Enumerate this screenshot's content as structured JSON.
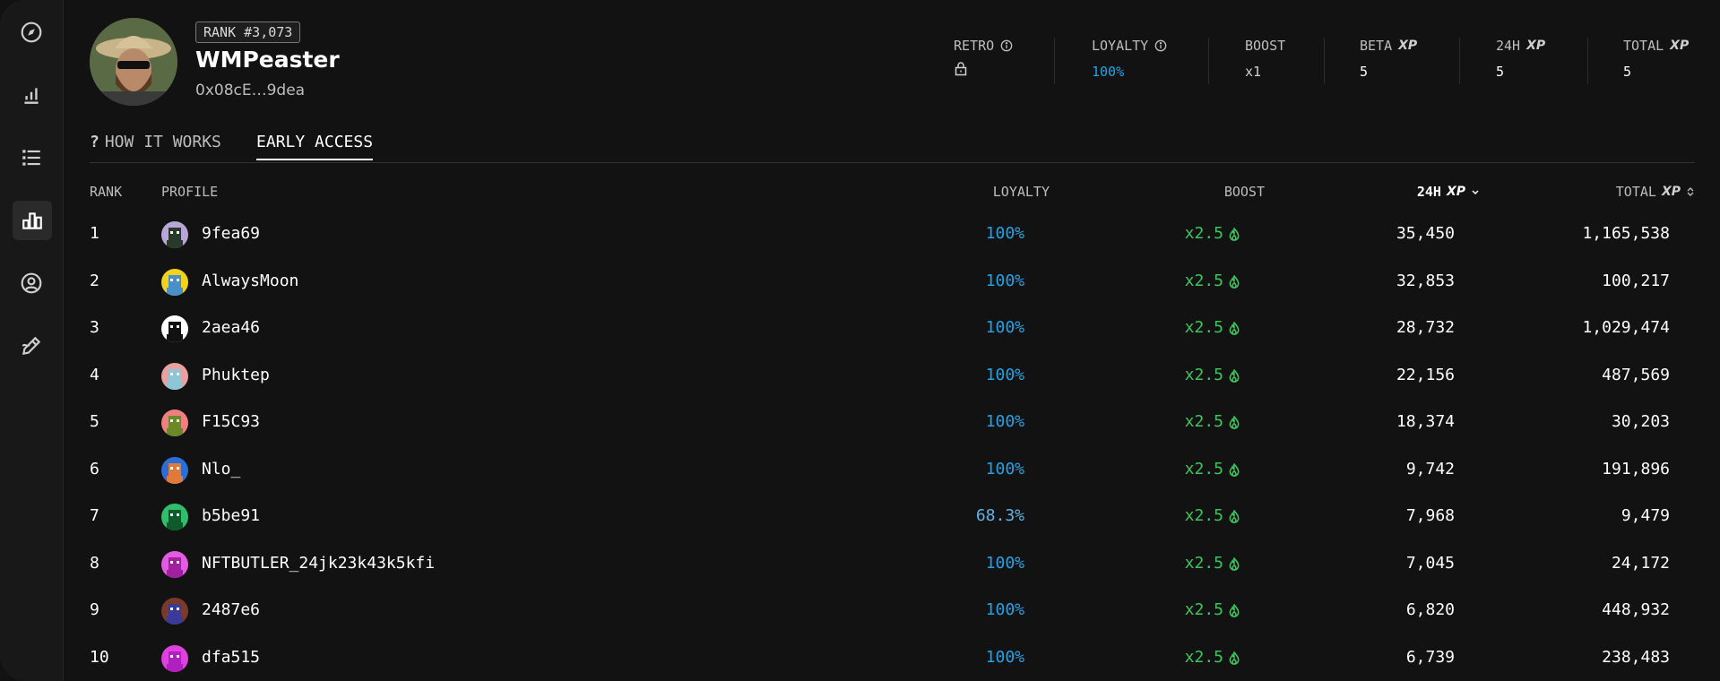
{
  "profile": {
    "rank_badge": "RANK #3,073",
    "name": "WMPeaster",
    "address": "0x08cE…9dea"
  },
  "stats": [
    {
      "label": "RETRO",
      "value": "",
      "value_icon": "lock-icon",
      "has_info": true
    },
    {
      "label": "LOYALTY",
      "value": "100%",
      "has_info": true,
      "accent": "#1fa3e8"
    },
    {
      "label": "BOOST",
      "value": "x1"
    },
    {
      "label": "BETA",
      "xp": "XP",
      "value": "5"
    },
    {
      "label": "24H",
      "xp": "XP",
      "value": "5"
    },
    {
      "label": "TOTAL",
      "xp": "XP",
      "value": "5"
    }
  ],
  "tabs": [
    {
      "label": "HOW IT WORKS",
      "icon": "question-mark-icon",
      "prefix": "?"
    },
    {
      "label": "EARLY ACCESS",
      "active": true
    }
  ],
  "table": {
    "headers": {
      "rank": "RANK",
      "profile": "PROFILE",
      "loyalty": "LOYALTY",
      "boost": "BOOST",
      "h24": "24H",
      "total": "TOTAL",
      "xp": "XP"
    },
    "rows": [
      {
        "rank": "1",
        "name": "9fea69",
        "loyalty": "100%",
        "boost": "x2.5",
        "h24": "35,450",
        "total": "1,165,538",
        "avatar": [
          "#b9a6d9",
          "#2a3a2a"
        ]
      },
      {
        "rank": "2",
        "name": "AlwaysMoon",
        "loyalty": "100%",
        "boost": "x2.5",
        "h24": "32,853",
        "total": "100,217",
        "avatar": [
          "#f2d21b",
          "#4a90c8"
        ]
      },
      {
        "rank": "3",
        "name": "2aea46",
        "loyalty": "100%",
        "boost": "x2.5",
        "h24": "28,732",
        "total": "1,029,474",
        "avatar": [
          "#ffffff",
          "#111111"
        ]
      },
      {
        "rank": "4",
        "name": "Phuktep",
        "loyalty": "100%",
        "boost": "x2.5",
        "h24": "22,156",
        "total": "487,569",
        "avatar": [
          "#e8a0a0",
          "#8ec6d8"
        ]
      },
      {
        "rank": "5",
        "name": "F15C93",
        "loyalty": "100%",
        "boost": "x2.5",
        "h24": "18,374",
        "total": "30,203",
        "avatar": [
          "#f08080",
          "#6a8a2a"
        ]
      },
      {
        "rank": "6",
        "name": "Nlo_",
        "loyalty": "100%",
        "boost": "x2.5",
        "h24": "9,742",
        "total": "191,896",
        "avatar": [
          "#2b6fd6",
          "#e07a3a"
        ]
      },
      {
        "rank": "7",
        "name": "b5be91",
        "loyalty": "68.3%",
        "boost": "x2.5",
        "h24": "7,968",
        "total": "9,479",
        "avatar": [
          "#2fbf6a",
          "#0f5a2a"
        ]
      },
      {
        "rank": "8",
        "name": "NFTBUTLER_24jk23k43k5kfi",
        "loyalty": "100%",
        "boost": "x2.5",
        "h24": "7,045",
        "total": "24,172",
        "avatar": [
          "#e25be0",
          "#a020a0"
        ]
      },
      {
        "rank": "9",
        "name": "2487e6",
        "loyalty": "100%",
        "boost": "x2.5",
        "h24": "6,820",
        "total": "448,932",
        "avatar": [
          "#7a3a2a",
          "#3a3a9a"
        ]
      },
      {
        "rank": "10",
        "name": "dfa515",
        "loyalty": "100%",
        "boost": "x2.5",
        "h24": "6,739",
        "total": "238,483",
        "avatar": [
          "#e040e0",
          "#b020c0"
        ]
      }
    ]
  },
  "colors": {
    "loyalty_full": "#1fa3e8",
    "loyalty_partial": "#5fb3e8",
    "boost": "#3ec45f"
  },
  "sidebar": [
    {
      "icon": "compass-icon"
    },
    {
      "icon": "bar-chart-icon"
    },
    {
      "icon": "list-icon"
    },
    {
      "icon": "leaderboard-icon",
      "active": true
    },
    {
      "icon": "user-circle-icon"
    },
    {
      "icon": "pencil-icon"
    }
  ]
}
